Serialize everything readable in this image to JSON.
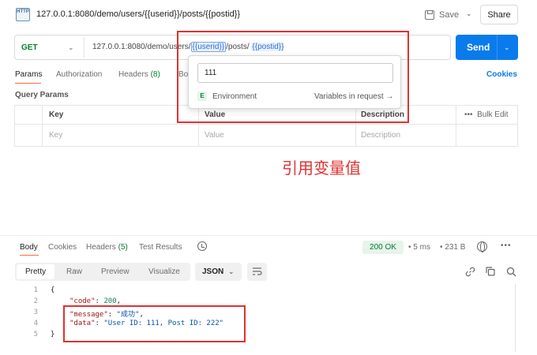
{
  "header": {
    "icon_text": "HTTP",
    "title": "127.0.0.1:8080/demo/users/{{userid}}/posts/{{postid}}",
    "save_label": "Save",
    "share_label": "Share"
  },
  "request": {
    "method": "GET",
    "url_prefix": "127.0.0.1:8080/demo/users/",
    "var1": "{{userid}}",
    "url_mid": "/posts/",
    "var2": "{{postid}}",
    "send_label": "Send"
  },
  "tabs": {
    "params": "Params",
    "authorization": "Authorization",
    "headers": "Headers",
    "headers_count": "(8)",
    "body_partial": "Bo",
    "cookies": "Cookies"
  },
  "query_params": {
    "title": "Query Params",
    "columns": [
      "Key",
      "Value",
      "Description"
    ],
    "bulk_edit": "Bulk Edit",
    "placeholders": [
      "Key",
      "Value",
      "Description"
    ]
  },
  "variable_popup": {
    "value": "111",
    "badge": "E",
    "scope": "Environment",
    "link": "Variables in request →"
  },
  "annotation": "引用变量值",
  "response": {
    "tabs": [
      "Body",
      "Cookies",
      "Headers",
      "Test Results"
    ],
    "headers_count": "(5)",
    "status": "200 OK",
    "time": "5 ms",
    "size": "231 B",
    "formats": [
      "Pretty",
      "Raw",
      "Preview",
      "Visualize"
    ],
    "language": "JSON",
    "code_lines": [
      {
        "num": "1",
        "text": "{"
      },
      {
        "num": "2",
        "key": "\"code\"",
        "value": "200",
        "tail": ","
      },
      {
        "num": "3",
        "key": "\"message\"",
        "value": "\"成功\"",
        "tail": ","
      },
      {
        "num": "4",
        "key": "\"data\"",
        "value": "\"User ID: 111, Post ID: 222\"",
        "tail": ""
      },
      {
        "num": "5",
        "text": "}"
      }
    ]
  },
  "colors": {
    "accent": "#097bed",
    "method_green": "#0b7a34",
    "annotation_red": "#e03131",
    "tab_underline": "#ff6c37"
  }
}
